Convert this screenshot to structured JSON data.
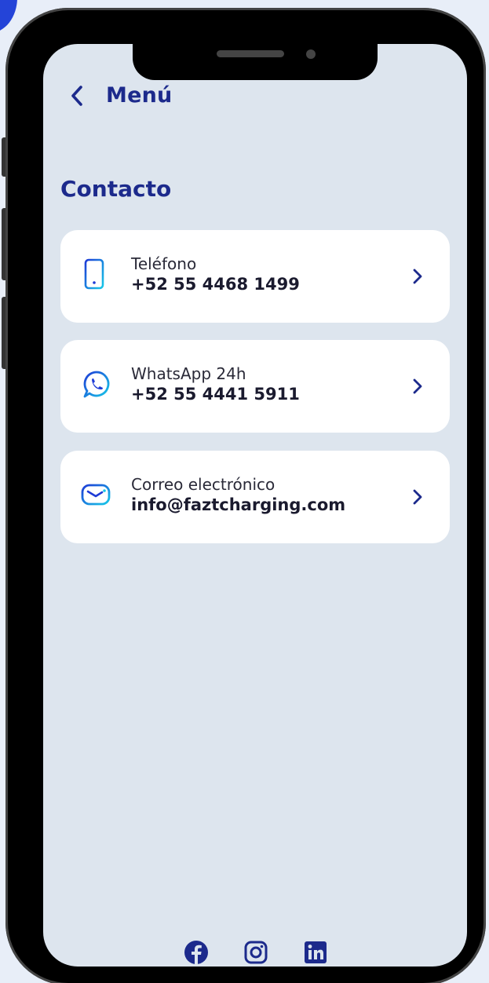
{
  "header": {
    "back_icon": "chevron-left-icon",
    "title": "Menú"
  },
  "section": {
    "title": "Contacto"
  },
  "contacts": [
    {
      "icon": "phone-icon",
      "label": "Teléfono",
      "value": "+52 55 4468 1499"
    },
    {
      "icon": "whatsapp-icon",
      "label": "WhatsApp 24h",
      "value": "+52 55 4441 5911"
    },
    {
      "icon": "mail-icon",
      "label": "Correo electrónico",
      "value": "info@faztcharging.com"
    }
  ],
  "socials": [
    "facebook-icon",
    "instagram-icon",
    "linkedin-icon"
  ],
  "colors": {
    "brand": "#1c2a8c",
    "icon_gradient_start": "#1e3bd6",
    "icon_gradient_end": "#17c8e8",
    "screen_bg": "#dde5ee",
    "card_bg": "#ffffff"
  }
}
